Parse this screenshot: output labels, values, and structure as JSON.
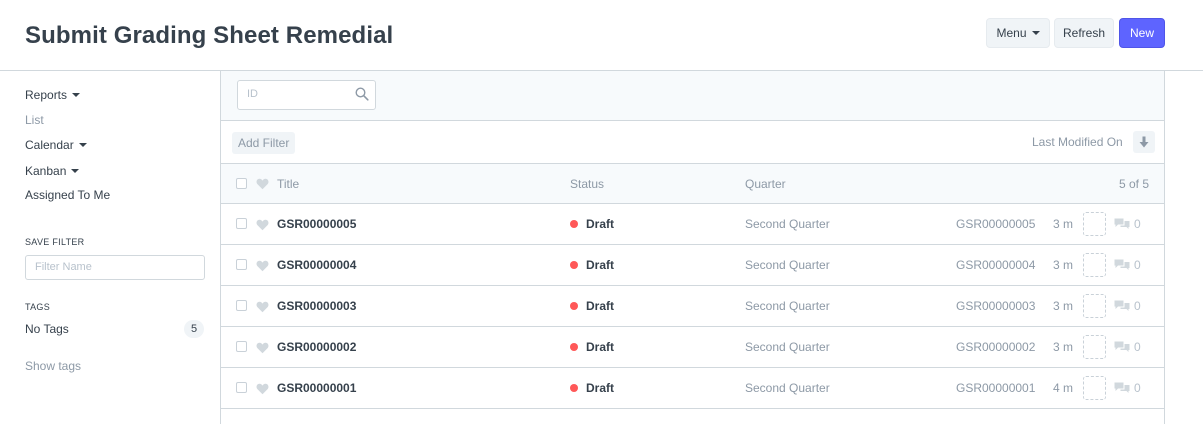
{
  "header": {
    "title": "Submit Grading Sheet Remedial",
    "menu_label": "Menu",
    "refresh_label": "Refresh",
    "new_label": "New"
  },
  "sidebar": {
    "items": [
      {
        "label": "Reports",
        "dropdown": true
      },
      {
        "label": "List",
        "dropdown": false
      },
      {
        "label": "Calendar",
        "dropdown": true
      },
      {
        "label": "Kanban",
        "dropdown": true
      },
      {
        "label": "Assigned To Me",
        "dropdown": false
      }
    ],
    "save_filter_heading": "SAVE FILTER",
    "filter_name_placeholder": "Filter Name",
    "tags_heading": "TAGS",
    "no_tags_label": "No Tags",
    "no_tags_count": "5",
    "show_tags_label": "Show tags"
  },
  "search": {
    "id_placeholder": "ID"
  },
  "filters": {
    "add_filter_label": "Add Filter",
    "sort_label": "Last Modified On"
  },
  "list": {
    "columns": {
      "title": "Title",
      "status": "Status",
      "quarter": "Quarter",
      "count": "5 of 5"
    },
    "rows": [
      {
        "title": "GSR00000005",
        "status": "Draft",
        "quarter": "Second Quarter",
        "name": "GSR00000005",
        "modified": "3 m",
        "comments": "0"
      },
      {
        "title": "GSR00000004",
        "status": "Draft",
        "quarter": "Second Quarter",
        "name": "GSR00000004",
        "modified": "3 m",
        "comments": "0"
      },
      {
        "title": "GSR00000003",
        "status": "Draft",
        "quarter": "Second Quarter",
        "name": "GSR00000003",
        "modified": "3 m",
        "comments": "0"
      },
      {
        "title": "GSR00000002",
        "status": "Draft",
        "quarter": "Second Quarter",
        "name": "GSR00000002",
        "modified": "3 m",
        "comments": "0"
      },
      {
        "title": "GSR00000001",
        "status": "Draft",
        "quarter": "Second Quarter",
        "name": "GSR00000001",
        "modified": "4 m",
        "comments": "0"
      }
    ]
  },
  "colors": {
    "primary": "#5e64ff",
    "draft_indicator": "#ff5858",
    "border": "#d1d8dd",
    "muted_text": "#8d99a6"
  }
}
